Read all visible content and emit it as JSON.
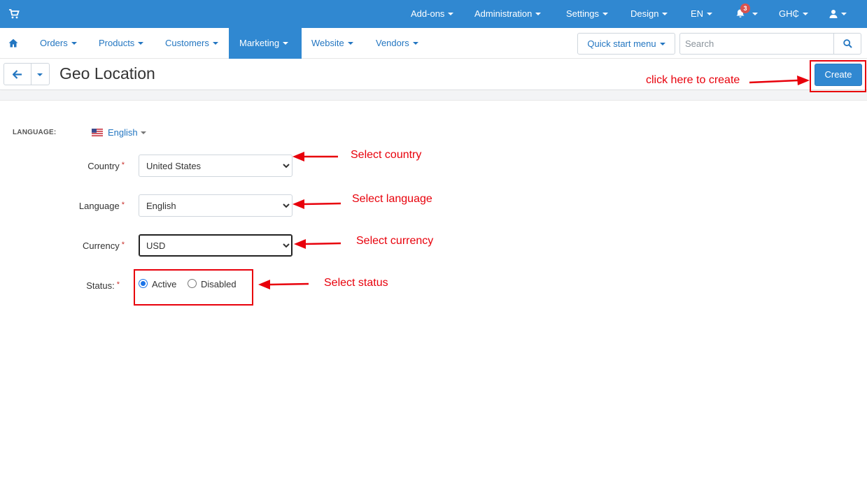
{
  "topbar": {
    "menus": [
      "Add-ons",
      "Administration",
      "Settings",
      "Design",
      "EN"
    ],
    "notifications_count": "3",
    "currency": "GH₵"
  },
  "nav": {
    "items": [
      "Orders",
      "Products",
      "Customers",
      "Marketing",
      "Website",
      "Vendors"
    ],
    "active": "Marketing",
    "quick_start": "Quick start menu",
    "search_placeholder": "Search"
  },
  "header": {
    "title": "Geo Location",
    "create_label": "Create"
  },
  "form": {
    "language_label": "LANGUAGE:",
    "language_value": "English",
    "country_label": "Country",
    "country_value": "United States",
    "language_field_label": "Language",
    "language_field_value": "English",
    "currency_label": "Currency",
    "currency_value": "USD",
    "status_label": "Status:",
    "status_options": [
      "Active",
      "Disabled"
    ],
    "status_selected": "Active",
    "required_mark": "*"
  },
  "annotations": {
    "create": "click here to create",
    "country": "Select country",
    "language": "Select language",
    "currency": "Select currency",
    "status": "Select status"
  },
  "colors": {
    "brand": "#3088d1",
    "link": "#2376c1",
    "annotation": "#e8000b",
    "badge": "#d9534f"
  },
  "icons": {
    "cart": "cart-icon",
    "bell": "bell-icon",
    "user": "user-icon",
    "home": "home-icon",
    "search": "search-icon",
    "back": "arrow-left-icon",
    "flag": "us-flag-icon"
  }
}
